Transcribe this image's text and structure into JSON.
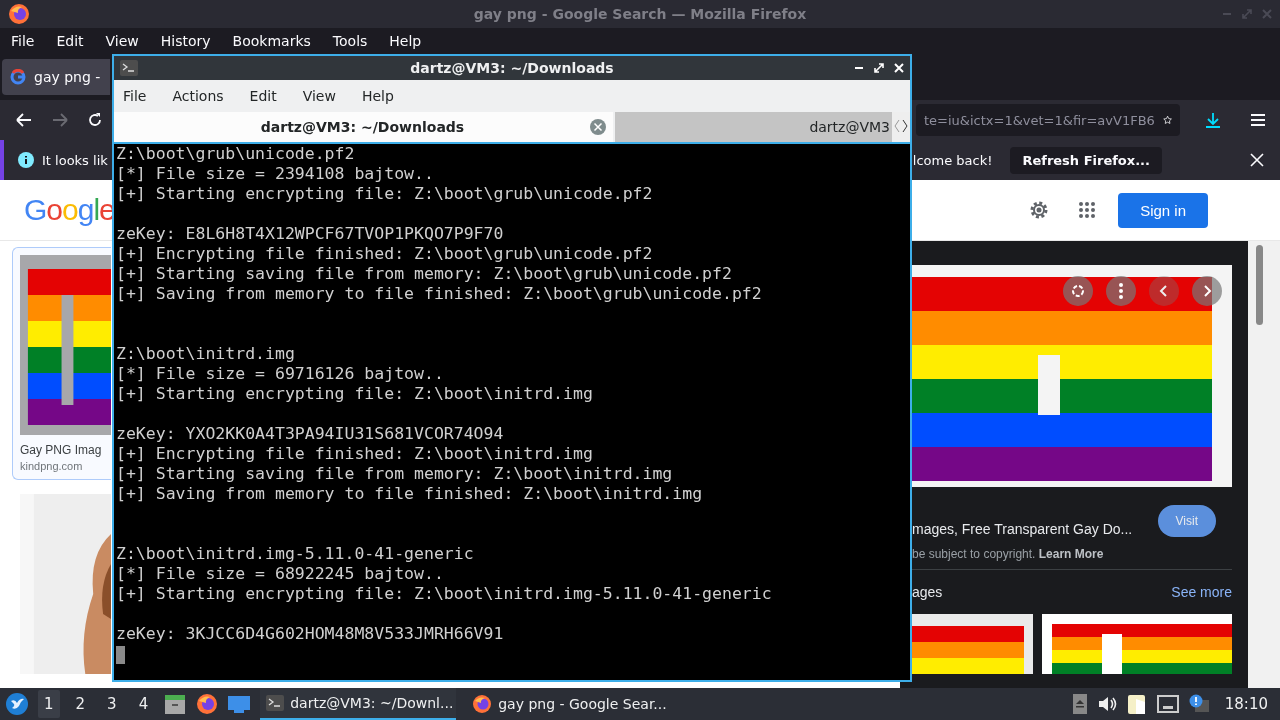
{
  "firefox": {
    "title": "gay png - Google Search — Mozilla Firefox",
    "menu": [
      "File",
      "Edit",
      "View",
      "History",
      "Bookmarks",
      "Tools",
      "Help"
    ],
    "tab": {
      "label": "gay png -",
      "selected": true
    },
    "nav": {
      "forward_disabled": true
    },
    "url": "te=iu&ictx=1&vet=1&fir=avV1FB6",
    "notice": {
      "text_left": "It looks lik",
      "text_right": "lcome back!",
      "button": "Refresh Firefox..."
    }
  },
  "google": {
    "logo": "Google",
    "sign_in": "Sign in",
    "results": [
      {
        "kind": "card",
        "caption": "Gay PNG Imag",
        "source": "kindpng.com"
      },
      {
        "kind": "picture"
      }
    ],
    "preview": {
      "title": "mages, Free Transparent Gay Do...",
      "visit": "Visit",
      "notice": "be subject to copyright. **Learn More**",
      "related": "ages",
      "see_more": "See more"
    }
  },
  "terminal": {
    "title": "dartz@VM3: ~/Downloads",
    "menu": [
      "File",
      "Actions",
      "Edit",
      "View",
      "Help"
    ],
    "tabs": [
      {
        "label": "dartz@VM3: ~/Downloads",
        "selected": true
      },
      {
        "label": "dartz@VM3",
        "selected": false
      }
    ],
    "files": [
      {
        "head": [
          "Z:\\boot\\grub\\unicode.pf2",
          "[*] File size = 2394108 bajtow..",
          "[+] Starting encrypting file: Z:\\boot\\grub\\unicode.pf2"
        ],
        "result": [
          "zeKey: E8L6H8T4X12WPCF67TVOP1PKQO7P9F70",
          "[+] Encrypting file finished: Z:\\boot\\grub\\unicode.pf2",
          "[+] Starting saving file from memory: Z:\\boot\\grub\\unicode.pf2",
          "[+] Saving from memory to file finished: Z:\\boot\\grub\\unicode.pf2"
        ]
      },
      {
        "head": [
          "Z:\\boot\\initrd.img",
          "[*] File size = 69716126 bajtow..",
          "[+] Starting encrypting file: Z:\\boot\\initrd.img"
        ],
        "result": [
          "zeKey: YXO2KK0A4T3PA94IU31S681VCOR74O94",
          "[+] Encrypting file finished: Z:\\boot\\initrd.img",
          "[+] Starting saving file from memory: Z:\\boot\\initrd.img",
          "[+] Saving from memory to file finished: Z:\\boot\\initrd.img"
        ]
      },
      {
        "head": [
          "Z:\\boot\\initrd.img-5.11.0-41-generic",
          "[*] File size = 68922245 bajtow..",
          "[+] Starting encrypting file: Z:\\boot\\initrd.img-5.11.0-41-generic"
        ],
        "result": [
          "zeKey: 3KJCC6D4G602HOM48M8V533JMRH66V91"
        ]
      }
    ]
  },
  "taskbar": {
    "workspaces": [
      {
        "label": "1",
        "selected": true
      },
      {
        "label": "2",
        "selected": false
      },
      {
        "label": "3",
        "selected": false
      },
      {
        "label": "4",
        "selected": false
      }
    ],
    "tasks": [
      {
        "kind": "terminal",
        "label": "dartz@VM3: ~/Downl...",
        "selected": true
      },
      {
        "kind": "browser",
        "label": "gay png - Google Sear...",
        "selected": false
      }
    ],
    "clock": "18:10"
  }
}
